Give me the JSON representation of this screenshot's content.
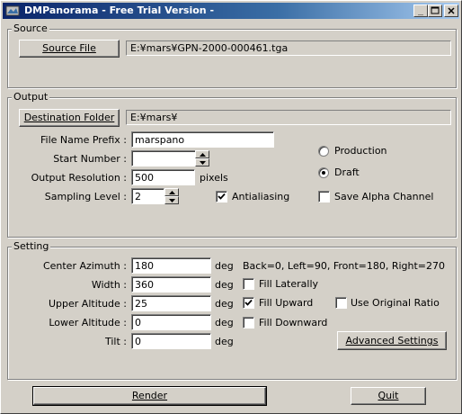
{
  "window": {
    "title": "DMPanorama - Free Trial Version -"
  },
  "source": {
    "group_label": "Source",
    "button_label": "Source File",
    "path": "E:¥mars¥GPN-2000-000461.tga"
  },
  "output": {
    "group_label": "Output",
    "dest_button_label": "Destination Folder",
    "dest_path": "E:¥mars¥",
    "prefix_label": "File Name Prefix :",
    "prefix_value": "marspano",
    "start_label": "Start Number :",
    "start_value": "",
    "resolution_label": "Output Resolution :",
    "resolution_value": "500",
    "resolution_unit": "pixels",
    "sampling_label": "Sampling Level :",
    "sampling_value": "2",
    "antialiasing_label": "Antialiasing",
    "antialiasing_checked": true,
    "production_label": "Production",
    "draft_label": "Draft",
    "mode_selected": "Draft",
    "alpha_label": "Save Alpha Channel",
    "alpha_checked": false
  },
  "setting": {
    "group_label": "Setting",
    "azimuth_label": "Center Azimuth :",
    "azimuth_value": "180",
    "width_label": "Width :",
    "width_value": "360",
    "upper_label": "Upper Altitude :",
    "upper_value": "25",
    "lower_label": "Lower Altitude :",
    "lower_value": "0",
    "tilt_label": "Tilt :",
    "tilt_value": "0",
    "unit": "deg",
    "azimuth_hint": "Back=0, Left=90, Front=180, Right=270",
    "fill_laterally_label": "Fill Laterally",
    "fill_laterally_checked": false,
    "fill_upward_label": "Fill Upward",
    "fill_upward_checked": true,
    "fill_downward_label": "Fill Downward",
    "fill_downward_checked": false,
    "original_ratio_label": "Use Original Ratio",
    "original_ratio_checked": false,
    "advanced_button_label": "Advanced Settings"
  },
  "footer": {
    "render_label": "Render",
    "quit_label": "Quit"
  }
}
